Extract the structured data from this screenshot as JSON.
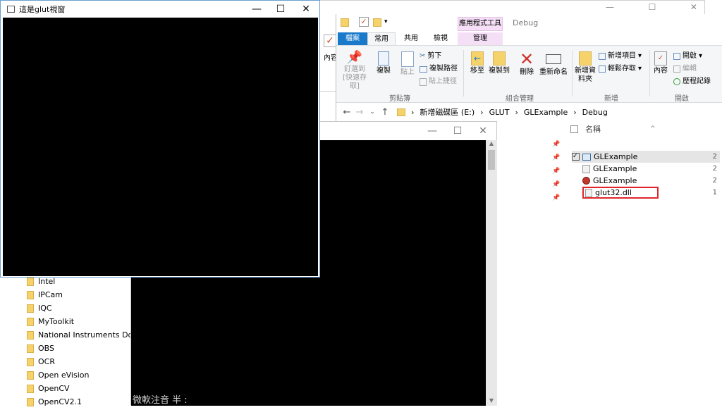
{
  "glut_window": {
    "title": "這是glut視窗",
    "controls": [
      "—",
      "☐",
      "✕"
    ]
  },
  "console_window": {
    "controls": [
      "—",
      "☐",
      "✕"
    ],
    "ime_status": "微軟注音 半 :"
  },
  "explorer": {
    "context_tab_label": "應用程式工具",
    "window_title": "Debug",
    "tabs": {
      "file": "檔案",
      "home": "常用",
      "share": "共用",
      "view": "檢視",
      "manage": "管理"
    },
    "ribbon": {
      "pin": "釘選到 [快速存取]",
      "copy": "複製",
      "paste": "貼上",
      "cut": "剪下",
      "copy_path": "複製路徑",
      "paste_shortcut": "貼上捷徑",
      "clipboard_label": "剪貼簿",
      "move_to": "移至",
      "copy_to": "複製到",
      "delete": "刪除",
      "rename": "重新命名",
      "organize_label": "組合管理",
      "new_folder": "新增資料夾",
      "new_item": "新增項目",
      "easy_access": "輕鬆存取",
      "new_label": "新增",
      "properties": "內容",
      "open": "開啟",
      "edit": "編輯",
      "history": "歷程記錄",
      "open_label": "開啟",
      "left_partial": "內容"
    },
    "breadcrumb": [
      "新增磁碟區 (E:)",
      "GLUT",
      "GLExample",
      "Debug"
    ],
    "column_name": "名稱",
    "files": [
      {
        "name": "GLExample",
        "size": "2",
        "selected": true
      },
      {
        "name": "GLExample",
        "size": "2",
        "selected": false
      },
      {
        "name": "GLExample",
        "size": "2",
        "selected": false
      },
      {
        "name": "glut32.dll",
        "size": "1",
        "selected": false,
        "highlighted": true
      }
    ]
  },
  "nav_tree": {
    "items": [
      "Intel",
      "IPCam",
      "IQC",
      "MyToolkit",
      "National Instruments Downloads",
      "OBS",
      "OCR",
      "Open eVision",
      "OpenCV",
      "OpenCV2.1"
    ]
  },
  "colors": {
    "accent_blue": "#1979ca",
    "highlight_red": "#e0262a",
    "context_tab": "#f5dff6"
  }
}
